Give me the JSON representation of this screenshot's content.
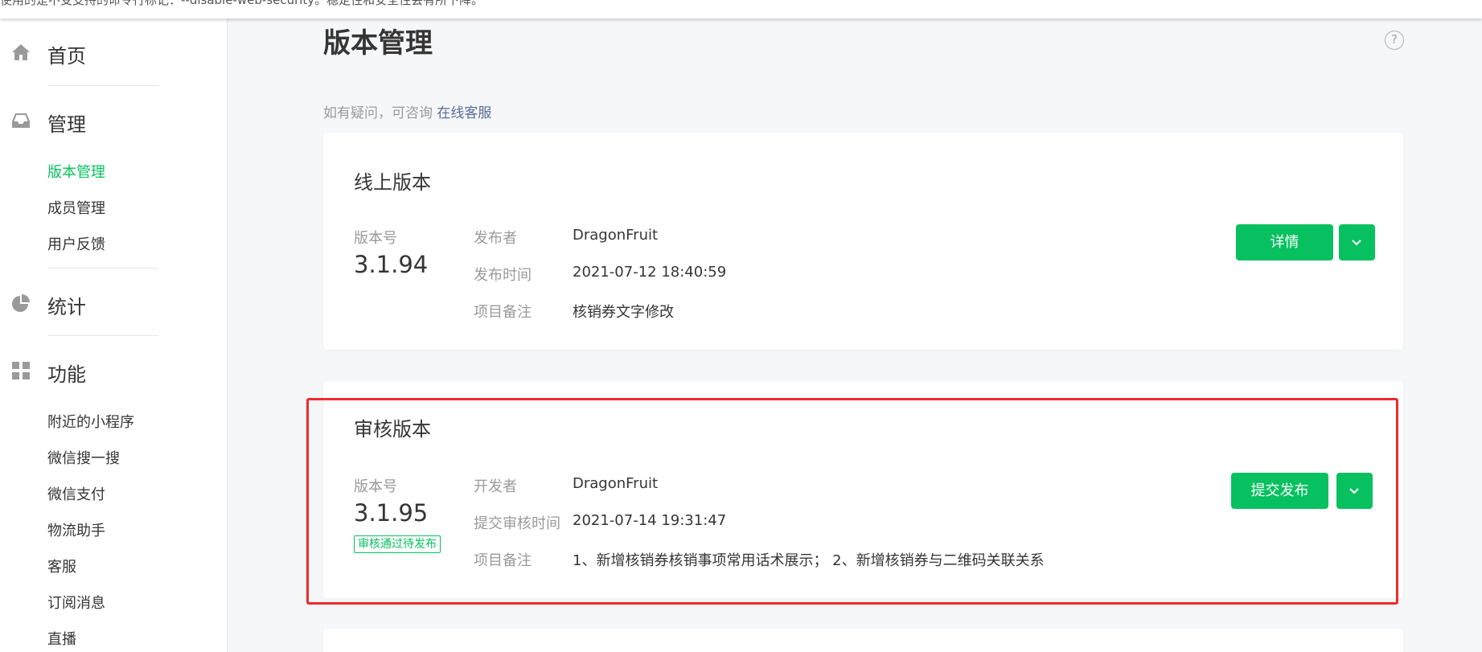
{
  "warning": {
    "text": "使用的是不受支持的命令行标记：--disable-web-security。稳定性和安全性会有所下降。"
  },
  "sidebar": {
    "groups": [
      {
        "icon": "home-icon",
        "label": "首页",
        "items": []
      },
      {
        "icon": "inbox-icon",
        "label": "管理",
        "items": [
          {
            "label": "版本管理",
            "active": true
          },
          {
            "label": "成员管理",
            "active": false
          },
          {
            "label": "用户反馈",
            "active": false
          }
        ]
      },
      {
        "icon": "pie-chart-icon",
        "label": "统计",
        "items": []
      },
      {
        "icon": "grid-icon",
        "label": "功能",
        "items": [
          {
            "label": "附近的小程序"
          },
          {
            "label": "微信搜一搜"
          },
          {
            "label": "微信支付"
          },
          {
            "label": "物流助手"
          },
          {
            "label": "客服"
          },
          {
            "label": "订阅消息"
          },
          {
            "label": "直播"
          }
        ]
      }
    ]
  },
  "main": {
    "title": "版本管理",
    "help_icon": "question-icon",
    "hint_text": "如有疑问，可咨询",
    "hint_link": "在线客服",
    "online_version": {
      "title": "线上版本",
      "version_label": "版本号",
      "version": "3.1.94",
      "fields": [
        {
          "label": "发布者",
          "value": "DragonFruit"
        },
        {
          "label": "发布时间",
          "value": "2021-07-12 18:40:59"
        },
        {
          "label": "项目备注",
          "value": "核销券文字修改"
        }
      ],
      "button_label": "详情"
    },
    "review_version": {
      "title": "审核版本",
      "version_label": "版本号",
      "version": "3.1.95",
      "status_badge": "审核通过待发布",
      "fields": [
        {
          "label": "开发者",
          "value": "DragonFruit"
        },
        {
          "label": "提交审核时间",
          "value": "2021-07-14 19:31:47"
        },
        {
          "label": "项目备注",
          "value": "1、新增核销券核销事项常用话术展示； 2、新增核销券与二维码关联关系"
        }
      ],
      "button_label": "提交发布"
    }
  },
  "colors": {
    "accent": "#07c160",
    "link": "#576b95",
    "highlight_frame": "#ef2b2b"
  }
}
